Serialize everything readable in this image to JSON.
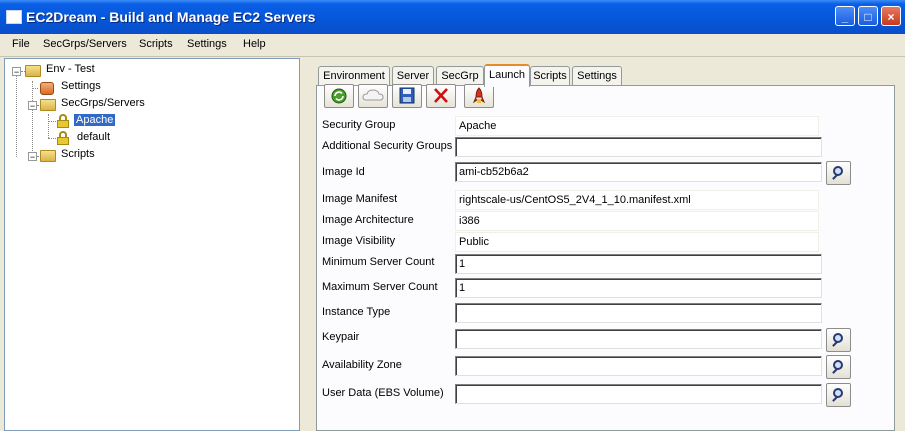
{
  "window": {
    "title": "EC2Dream - Build and Manage EC2 Servers",
    "minimize": "_",
    "maximize": "□",
    "close": "×"
  },
  "menu": [
    "File",
    "SecGrps/Servers",
    "Scripts",
    "Settings",
    "Help"
  ],
  "tree": {
    "root": "Env - Test",
    "settings": "Settings",
    "secgrps": "SecGrps/Servers",
    "apache": "Apache",
    "default": "default",
    "scripts": "Scripts"
  },
  "tabs": [
    "Environment",
    "Server",
    "SecGrp",
    "Launch",
    "Scripts",
    "Settings"
  ],
  "active_tab": "Launch",
  "toolbar": [
    "refresh-icon",
    "cloud-icon",
    "save-icon",
    "delete-icon",
    "launch-icon"
  ],
  "form": {
    "security_group": {
      "label": "Security Group",
      "value": "Apache"
    },
    "additional_security_groups": {
      "label": "Additional Security Groups",
      "value": ""
    },
    "image_id": {
      "label": "Image Id",
      "value": "ami-cb52b6a2"
    },
    "image_manifest": {
      "label": "Image Manifest",
      "value": "rightscale-us/CentOS5_2V4_1_10.manifest.xml"
    },
    "image_architecture": {
      "label": "Image Architecture",
      "value": "i386"
    },
    "image_visibility": {
      "label": "Image Visibility",
      "value": "Public"
    },
    "minimum_server_count": {
      "label": "Minimum Server Count",
      "value": "1"
    },
    "maximum_server_count": {
      "label": "Maximum Server Count",
      "value": "1"
    },
    "instance_type": {
      "label": "Instance Type",
      "value": ""
    },
    "keypair": {
      "label": "Keypair",
      "value": ""
    },
    "availability_zone": {
      "label": "Availability Zone",
      "value": ""
    },
    "user_data": {
      "label": "User Data (EBS Volume)",
      "value": ""
    }
  }
}
